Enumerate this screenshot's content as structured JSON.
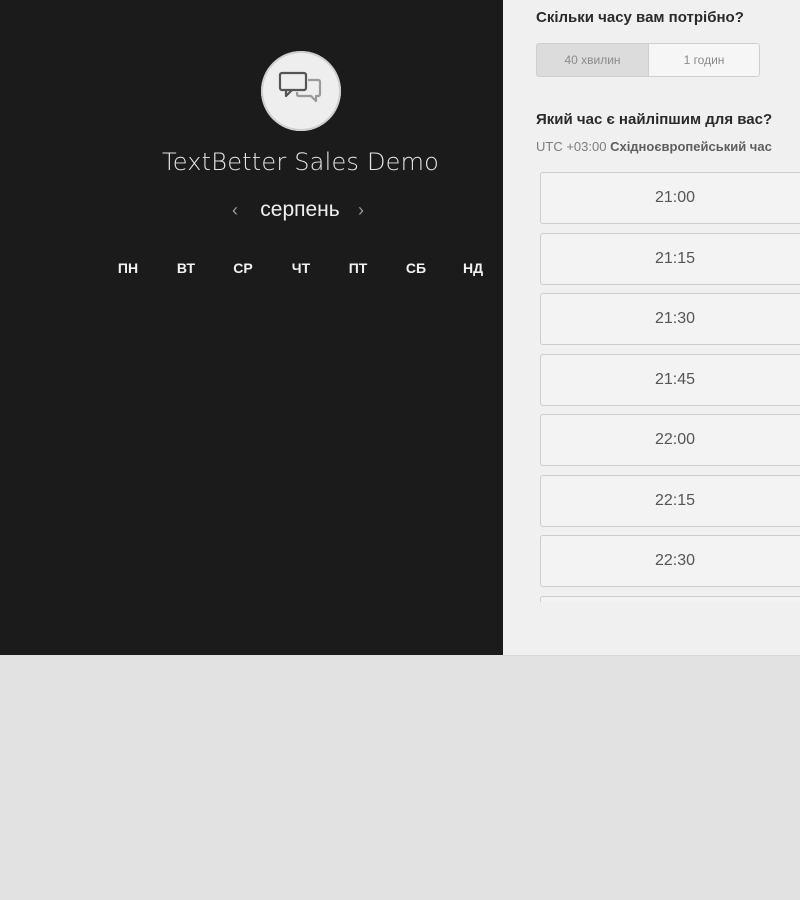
{
  "brand": {
    "name": "TextBetter Sales Demo",
    "logo_icon": "chat-bubbles-icon"
  },
  "calendar": {
    "month": "серпень",
    "prev_icon": "chevron-left-icon",
    "next_icon": "chevron-right-icon",
    "weekdays": [
      "ПН",
      "ВТ",
      "СР",
      "ЧТ",
      "ПТ",
      "СБ",
      "НД"
    ]
  },
  "duration": {
    "title": "Скільки часу вам потрібно?",
    "options": [
      "40 хвилин",
      "1 годин"
    ],
    "selected": "40 хвилин"
  },
  "time": {
    "title": "Який час є найліпшим для вас?",
    "timezone_offset": "UTC +03:00",
    "timezone_name": "Східноєвропейський час",
    "slots": [
      "21:00",
      "21:15",
      "21:30",
      "21:45",
      "22:00",
      "22:15",
      "22:30"
    ]
  },
  "colors": {
    "left_panel": "#1b1b1c",
    "right_panel": "#f0f0f0",
    "page_background": "#e2e2e2"
  }
}
